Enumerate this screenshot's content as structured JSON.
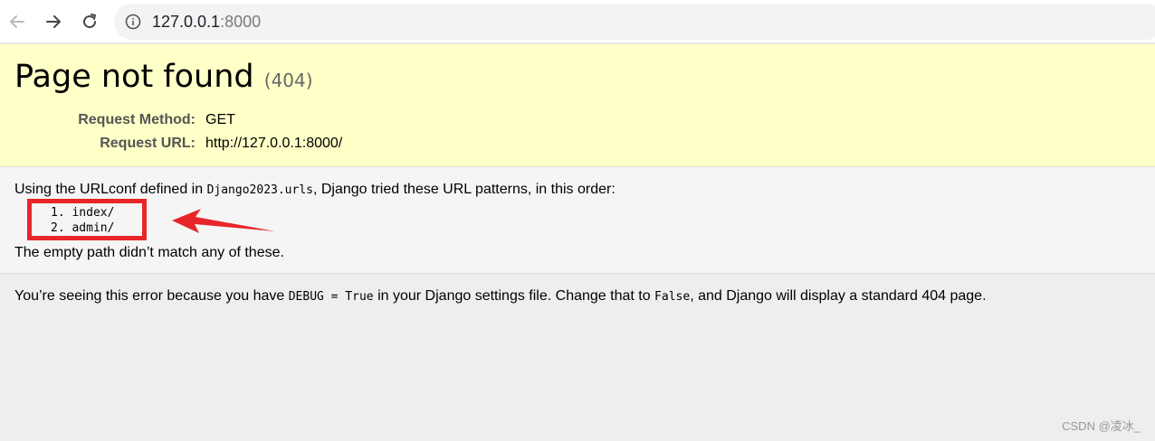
{
  "browser": {
    "url_host": "127.0.0.1",
    "url_port": ":8000",
    "icons": [
      "back-arrow-icon",
      "forward-arrow-icon",
      "reload-icon",
      "info-icon"
    ]
  },
  "error": {
    "title": "Page not found",
    "status_code": "(404)",
    "request_method_label": "Request Method:",
    "request_method": "GET",
    "request_url_label": "Request URL:",
    "request_url": "http://127.0.0.1:8000/"
  },
  "info": {
    "intro_before": "Using the URLconf defined in ",
    "urlconf": "Django2023.urls",
    "intro_after": ", Django tried these URL patterns, in this order:",
    "patterns": [
      "1. index/",
      "2. admin/"
    ],
    "no_match": "The empty path didn’t match any of these."
  },
  "explanation": {
    "before_debug": "You’re seeing this error because you have ",
    "debug_code": "DEBUG = True",
    "middle": " in your Django settings file. Change that to ",
    "false_code": "False",
    "after": ", and Django will display a standard 404 page."
  },
  "annotation": {
    "highlight_color": "#e8262a"
  },
  "watermark": "CSDN @凌冰_"
}
